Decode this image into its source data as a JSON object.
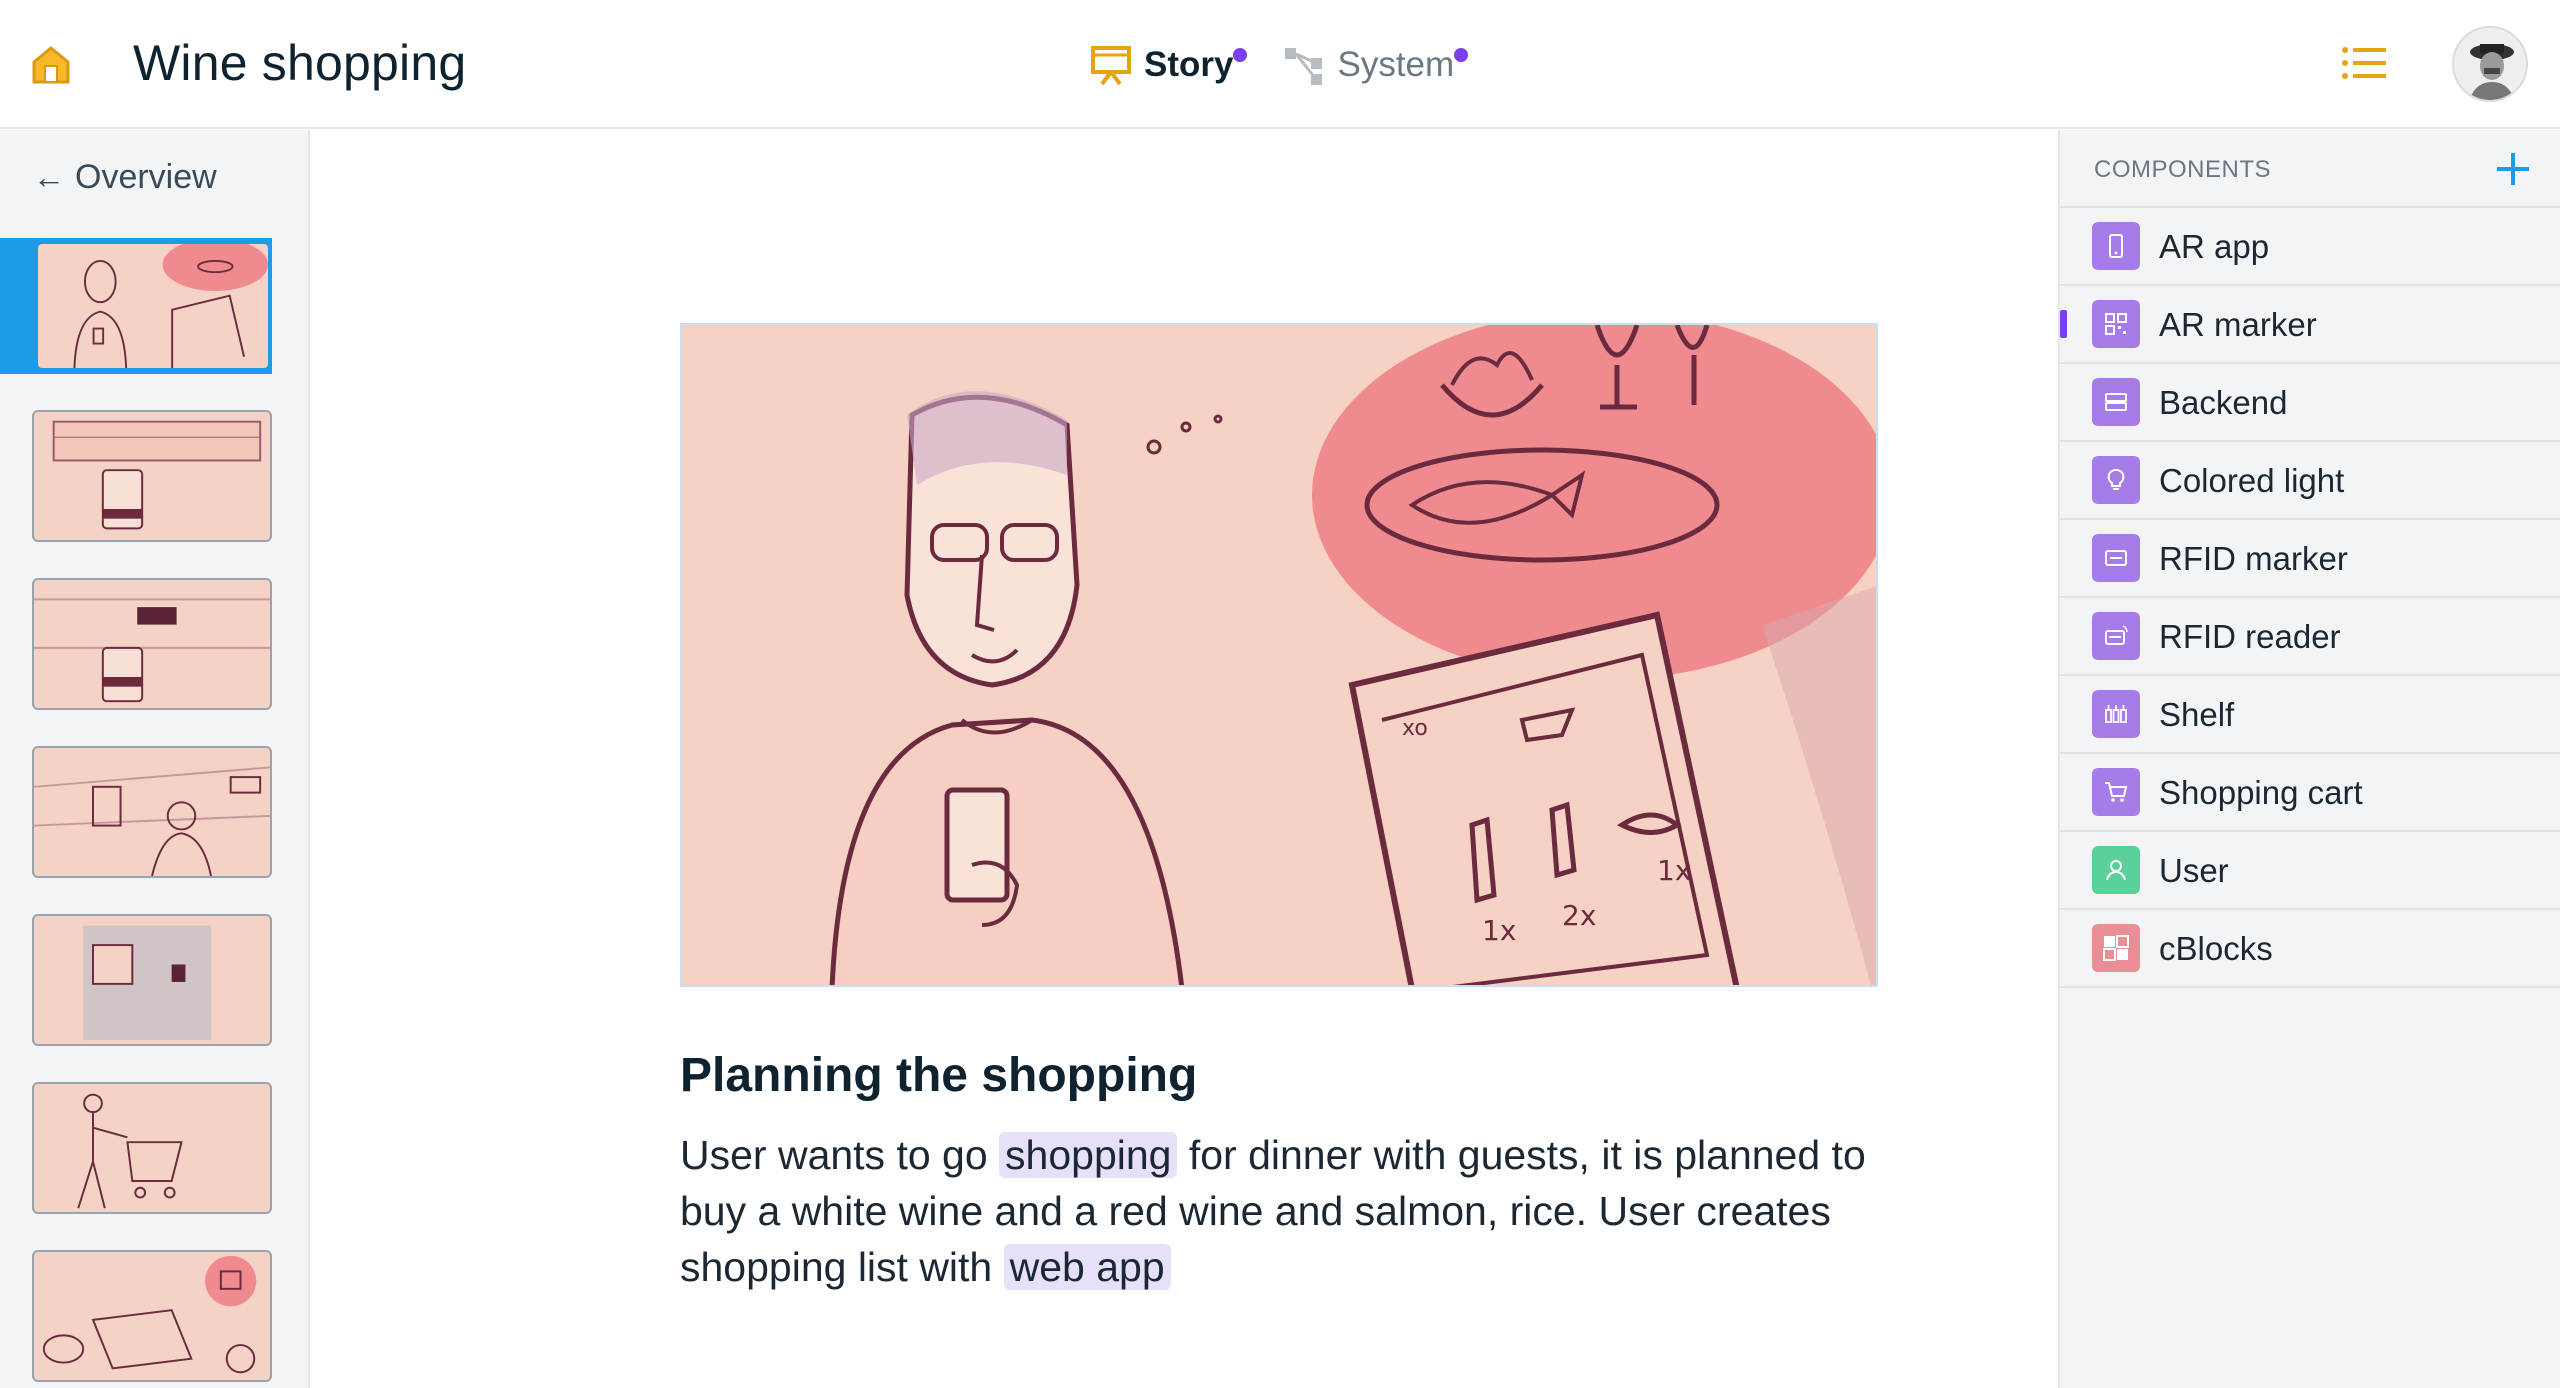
{
  "header": {
    "title": "Wine shopping",
    "modes": [
      {
        "label": "Story",
        "active": true,
        "icon": "presentation-icon"
      },
      {
        "label": "System",
        "active": false,
        "icon": "system-graph-icon"
      }
    ],
    "home_icon": "home-icon",
    "menu_icon": "list-icon",
    "accent_color": "#e3a512",
    "notification_dot_color": "#7b3ff2"
  },
  "left": {
    "overview_label": "Overview",
    "selection_color": "#1d9be6",
    "thumbnails": [
      {
        "scene": "planning-shopping",
        "active": true
      },
      {
        "scene": "store-sync",
        "active": false
      },
      {
        "scene": "shelf-sync",
        "active": false
      },
      {
        "scene": "ar-app-shelf",
        "active": false
      },
      {
        "scene": "store-shelf",
        "active": false
      },
      {
        "scene": "shopping-cart",
        "active": false
      },
      {
        "scene": "checkout",
        "active": false
      }
    ]
  },
  "main": {
    "scene_title": "Planning the shopping",
    "description_parts": [
      {
        "text": "User wants to go ",
        "tag": false
      },
      {
        "text": "shopping",
        "tag": true
      },
      {
        "text": " for dinner with guests, it is planned to buy a white wine and a red wine and salmon, rice. User creates shopping list with ",
        "tag": false
      },
      {
        "text": "web app",
        "tag": true
      }
    ]
  },
  "components": {
    "title": "COMPONENTS",
    "add_icon": "plus-icon",
    "items": [
      {
        "label": "AR app",
        "icon": "phone-icon",
        "color": "#a67ce8"
      },
      {
        "label": "AR marker",
        "icon": "qr-code-icon",
        "color": "#a67ce8",
        "marked": true
      },
      {
        "label": "Backend",
        "icon": "server-icon",
        "color": "#a67ce8"
      },
      {
        "label": "Colored light",
        "icon": "bulb-icon",
        "color": "#a67ce8"
      },
      {
        "label": "RFID marker",
        "icon": "card-icon",
        "color": "#a67ce8"
      },
      {
        "label": "RFID reader",
        "icon": "card-reader-icon",
        "color": "#a67ce8"
      },
      {
        "label": "Shelf",
        "icon": "bottles-icon",
        "color": "#a67ce8"
      },
      {
        "label": "Shopping cart",
        "icon": "cart-icon",
        "color": "#a67ce8"
      },
      {
        "label": "User",
        "icon": "user-icon",
        "color": "#5ad19b"
      },
      {
        "label": "cBlocks",
        "icon": "blocks-icon",
        "color": "#e88e96"
      }
    ]
  }
}
